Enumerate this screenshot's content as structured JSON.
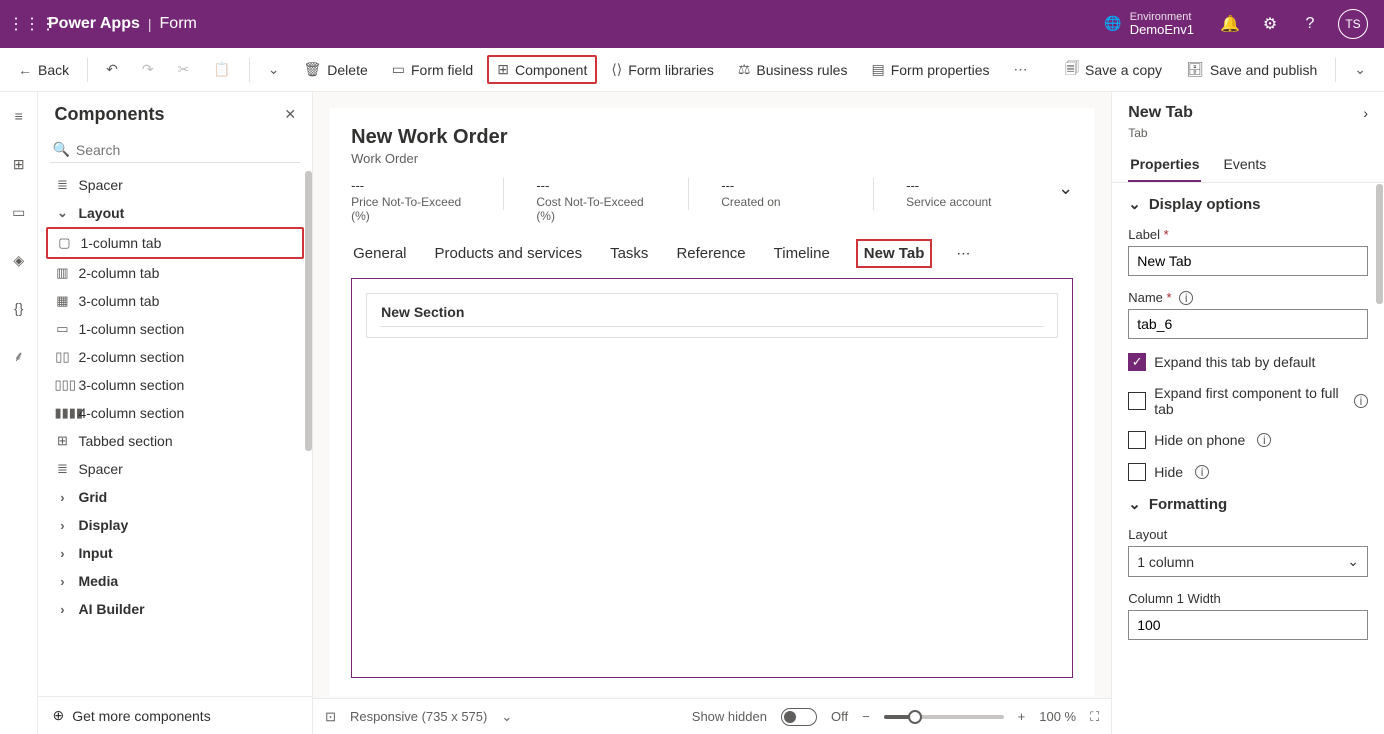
{
  "topbar": {
    "brand": "Power Apps",
    "page": "Form",
    "env_label": "Environment",
    "env_name": "DemoEnv1",
    "avatar": "TS"
  },
  "cmdbar": {
    "back": "Back",
    "delete": "Delete",
    "form_field": "Form field",
    "component": "Component",
    "form_libraries": "Form libraries",
    "business_rules": "Business rules",
    "form_properties": "Form properties",
    "save_copy": "Save a copy",
    "save_publish": "Save and publish"
  },
  "panel": {
    "title": "Components",
    "search_placeholder": "Search",
    "items": [
      {
        "type": "item",
        "icon": "≣",
        "label": "Spacer"
      },
      {
        "type": "group",
        "icon": "⌄",
        "label": "Layout"
      },
      {
        "type": "item",
        "icon": "▢",
        "label": "1-column tab",
        "highlight": true
      },
      {
        "type": "item",
        "icon": "▥",
        "label": "2-column tab"
      },
      {
        "type": "item",
        "icon": "▦",
        "label": "3-column tab"
      },
      {
        "type": "item",
        "icon": "▭",
        "label": "1-column section"
      },
      {
        "type": "item",
        "icon": "▯▯",
        "label": "2-column section"
      },
      {
        "type": "item",
        "icon": "▯▯▯",
        "label": "3-column section"
      },
      {
        "type": "item",
        "icon": "▮▮▮▮",
        "label": "4-column section"
      },
      {
        "type": "item",
        "icon": "⊞",
        "label": "Tabbed section"
      },
      {
        "type": "item",
        "icon": "≣",
        "label": "Spacer"
      },
      {
        "type": "group",
        "icon": "›",
        "label": "Grid"
      },
      {
        "type": "group",
        "icon": "›",
        "label": "Display"
      },
      {
        "type": "group",
        "icon": "›",
        "label": "Input"
      },
      {
        "type": "group",
        "icon": "›",
        "label": "Media"
      },
      {
        "type": "group",
        "icon": "›",
        "label": "AI Builder"
      }
    ],
    "footer": "Get more components"
  },
  "form": {
    "title": "New Work Order",
    "subtitle": "Work Order",
    "header_fields": [
      {
        "value": "---",
        "label": "Price Not-To-Exceed (%)"
      },
      {
        "value": "---",
        "label": "Cost Not-To-Exceed (%)"
      },
      {
        "value": "---",
        "label": "Created on"
      },
      {
        "value": "---",
        "label": "Service account"
      }
    ],
    "tabs": [
      "General",
      "Products and services",
      "Tasks",
      "Reference",
      "Timeline",
      "New Tab"
    ],
    "active_tab": "New Tab",
    "section_title": "New Section"
  },
  "statusbar": {
    "viewport": "Responsive (735 x 575)",
    "show_hidden": "Show hidden",
    "toggle_label": "Off",
    "zoom": "100 %"
  },
  "props": {
    "title": "New Tab",
    "crumb": "Tab",
    "tabs": [
      "Properties",
      "Events"
    ],
    "active": "Properties",
    "section_display": "Display options",
    "label_field": "Label",
    "label_value": "New Tab",
    "name_field": "Name",
    "name_value": "tab_6",
    "cb_expand_default": "Expand this tab by default",
    "cb_expand_first": "Expand first component to full tab",
    "cb_hide_phone": "Hide on phone",
    "cb_hide": "Hide",
    "section_formatting": "Formatting",
    "layout_label": "Layout",
    "layout_value": "1 column",
    "col_width_label": "Column 1 Width",
    "col_width_value": "100"
  }
}
